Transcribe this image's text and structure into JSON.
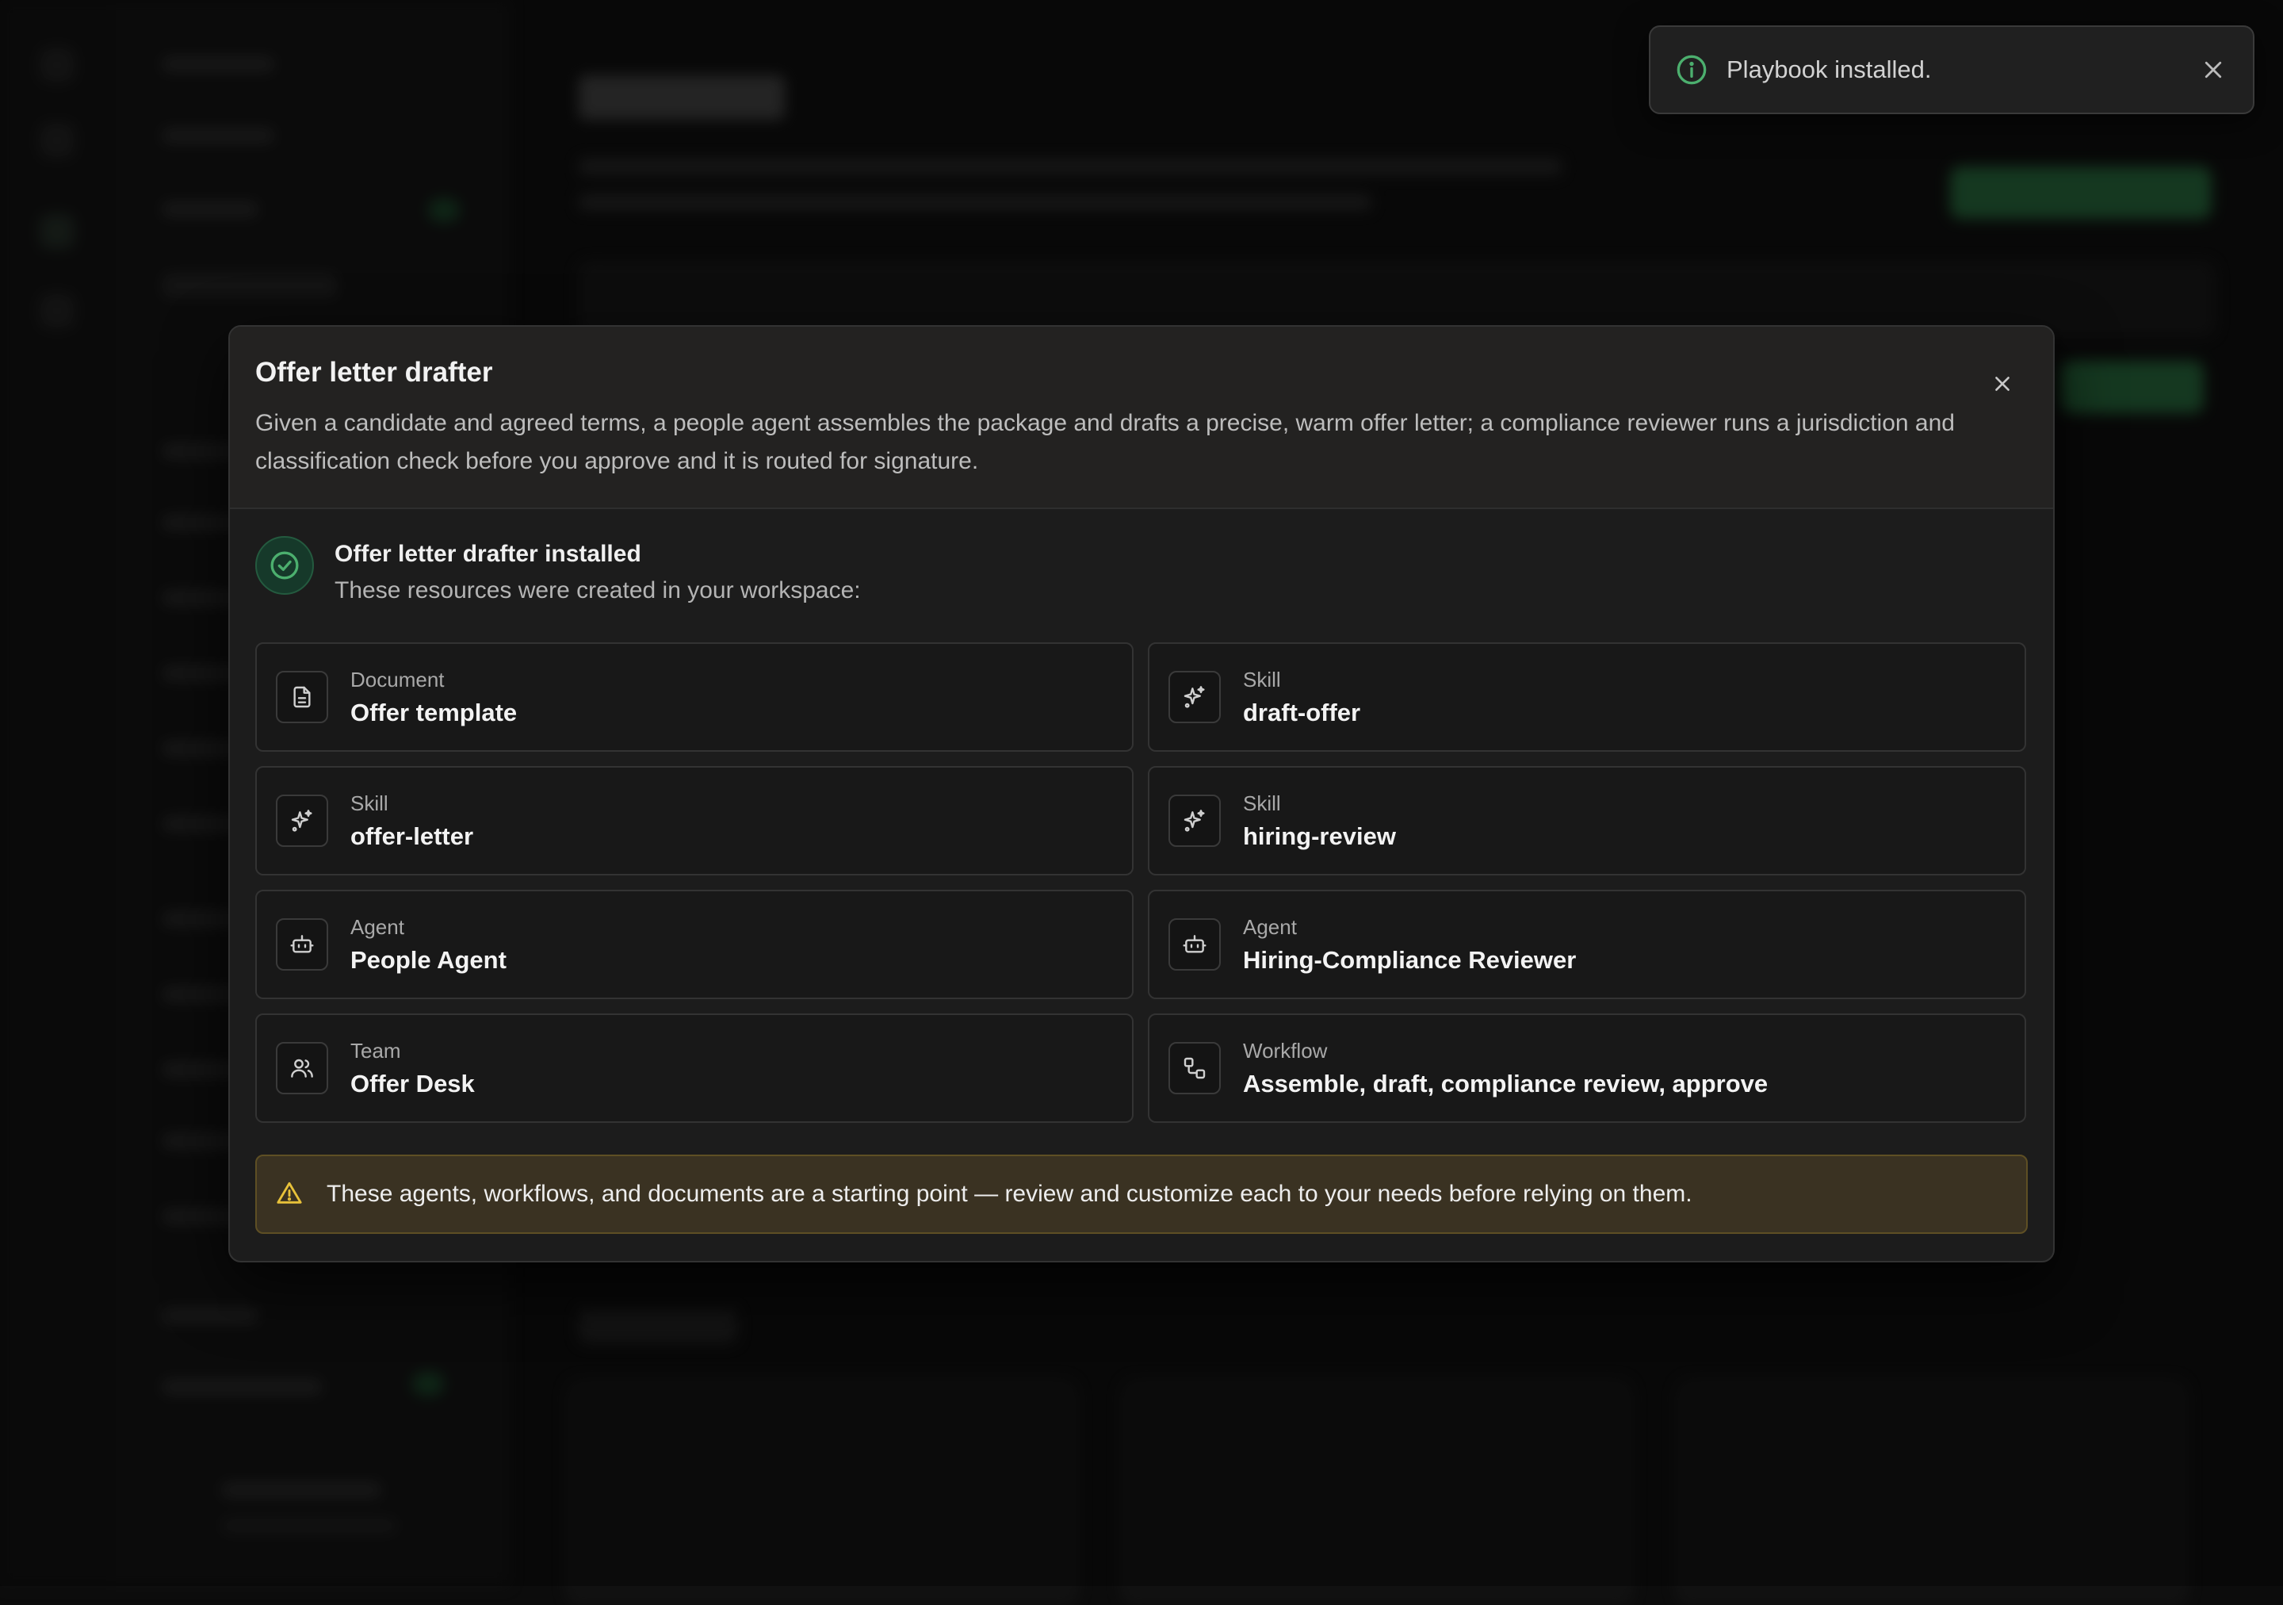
{
  "toast": {
    "message": "Playbook installed.",
    "icon": "info-icon",
    "accent": "#4caf6e"
  },
  "modal": {
    "title": "Offer letter drafter",
    "description": "Given a candidate and agreed terms, a people agent assembles the package and drafts a precise, warm offer letter; a compliance reviewer runs a jurisdiction and classification check before you approve and it is routed for signature.",
    "success": {
      "title": "Offer letter drafter installed",
      "subtitle": "These resources were created in your workspace:",
      "accent": "#4caf6e"
    },
    "resources": [
      {
        "type": "Document",
        "name": "Offer template",
        "icon": "document-icon"
      },
      {
        "type": "Skill",
        "name": "draft-offer",
        "icon": "sparkles-icon"
      },
      {
        "type": "Skill",
        "name": "offer-letter",
        "icon": "sparkles-icon"
      },
      {
        "type": "Skill",
        "name": "hiring-review",
        "icon": "sparkles-icon"
      },
      {
        "type": "Agent",
        "name": "People Agent",
        "icon": "bot-icon"
      },
      {
        "type": "Agent",
        "name": "Hiring-Compliance Reviewer",
        "icon": "bot-icon"
      },
      {
        "type": "Team",
        "name": "Offer Desk",
        "icon": "users-icon"
      },
      {
        "type": "Workflow",
        "name": "Assemble, draft, compliance review, approve",
        "icon": "workflow-icon"
      }
    ],
    "warning": {
      "text": "These agents, workflows, and documents are a starting point — review and customize each to your needs before relying on them.",
      "icon": "warning-icon",
      "color": "#e8c23a"
    }
  }
}
